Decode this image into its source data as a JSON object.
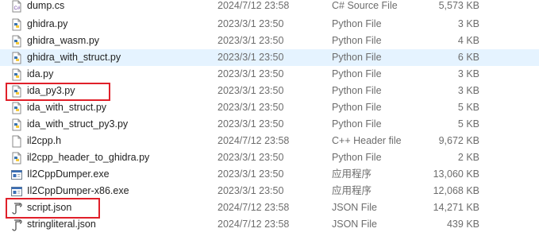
{
  "files": [
    {
      "name": "dump.cs",
      "date": "2024/7/12 23:58",
      "type": "C# Source File",
      "size": "5,573 KB",
      "icon": "csharp-file-icon"
    },
    {
      "name": "ghidra.py",
      "date": "2023/3/1 23:50",
      "type": "Python File",
      "size": "3 KB",
      "icon": "python-file-icon"
    },
    {
      "name": "ghidra_wasm.py",
      "date": "2023/3/1 23:50",
      "type": "Python File",
      "size": "4 KB",
      "icon": "python-file-icon"
    },
    {
      "name": "ghidra_with_struct.py",
      "date": "2023/3/1 23:50",
      "type": "Python File",
      "size": "6 KB",
      "icon": "python-file-icon"
    },
    {
      "name": "ida.py",
      "date": "2023/3/1 23:50",
      "type": "Python File",
      "size": "3 KB",
      "icon": "python-file-icon"
    },
    {
      "name": "ida_py3.py",
      "date": "2023/3/1 23:50",
      "type": "Python File",
      "size": "3 KB",
      "icon": "python-file-icon"
    },
    {
      "name": "ida_with_struct.py",
      "date": "2023/3/1 23:50",
      "type": "Python File",
      "size": "5 KB",
      "icon": "python-file-icon"
    },
    {
      "name": "ida_with_struct_py3.py",
      "date": "2023/3/1 23:50",
      "type": "Python File",
      "size": "5 KB",
      "icon": "python-file-icon"
    },
    {
      "name": "il2cpp.h",
      "date": "2024/7/12 23:58",
      "type": "C++ Header file",
      "size": "9,672 KB",
      "icon": "header-file-icon"
    },
    {
      "name": "il2cpp_header_to_ghidra.py",
      "date": "2023/3/1 23:50",
      "type": "Python File",
      "size": "2 KB",
      "icon": "python-file-icon"
    },
    {
      "name": "Il2CppDumper.exe",
      "date": "2023/3/1 23:50",
      "type": "应用程序",
      "size": "13,060 KB",
      "icon": "exe-file-icon"
    },
    {
      "name": "Il2CppDumper-x86.exe",
      "date": "2023/3/1 23:50",
      "type": "应用程序",
      "size": "12,068 KB",
      "icon": "exe-file-icon"
    },
    {
      "name": "script.json",
      "date": "2024/7/12 23:58",
      "type": "JSON File",
      "size": "14,271 KB",
      "icon": "json-file-icon"
    },
    {
      "name": "stringliteral.json",
      "date": "2024/7/12 23:58",
      "type": "JSON File",
      "size": "439 KB",
      "icon": "json-file-icon"
    }
  ],
  "selected_file": "ghidra_with_struct.py",
  "highlighted_files": [
    "ida_py3.py",
    "script.json"
  ],
  "colors": {
    "highlight_border": "#e0202a",
    "selection_background": "#e5f3ff",
    "python_blue": "#3a75b0",
    "python_yellow": "#f5c93a"
  }
}
